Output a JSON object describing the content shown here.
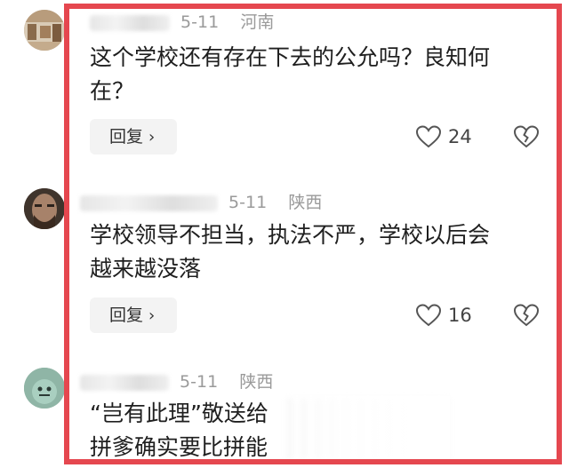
{
  "comments": [
    {
      "meta_date": "5-11",
      "meta_location": "河南",
      "text_line1": "这个学校还有存在下去的公允吗？良知何",
      "text_line2": "在？",
      "reply_label": "回复",
      "reply_chevron": "›",
      "like_count": "24",
      "like_icon": "heart-outline-icon",
      "dislike_icon": "broken-heart-icon"
    },
    {
      "meta_date": "5-11",
      "meta_location": "陕西",
      "text_line1": "学校领导不担当，执法不严，学校以后会",
      "text_line2": "越来越没落",
      "reply_label": "回复",
      "reply_chevron": "›",
      "like_count": "16",
      "like_icon": "heart-outline-icon",
      "dislike_icon": "broken-heart-icon"
    },
    {
      "meta_date": "5-11",
      "meta_location": "陕西",
      "text_line1": "“岂有此理”敬送给",
      "text_line2": "拼爹确实要比拼能"
    }
  ],
  "colors": {
    "frame": "#e5474f",
    "meta_gray": "#9a9a9a",
    "reply_bg": "#f3f3f3"
  }
}
